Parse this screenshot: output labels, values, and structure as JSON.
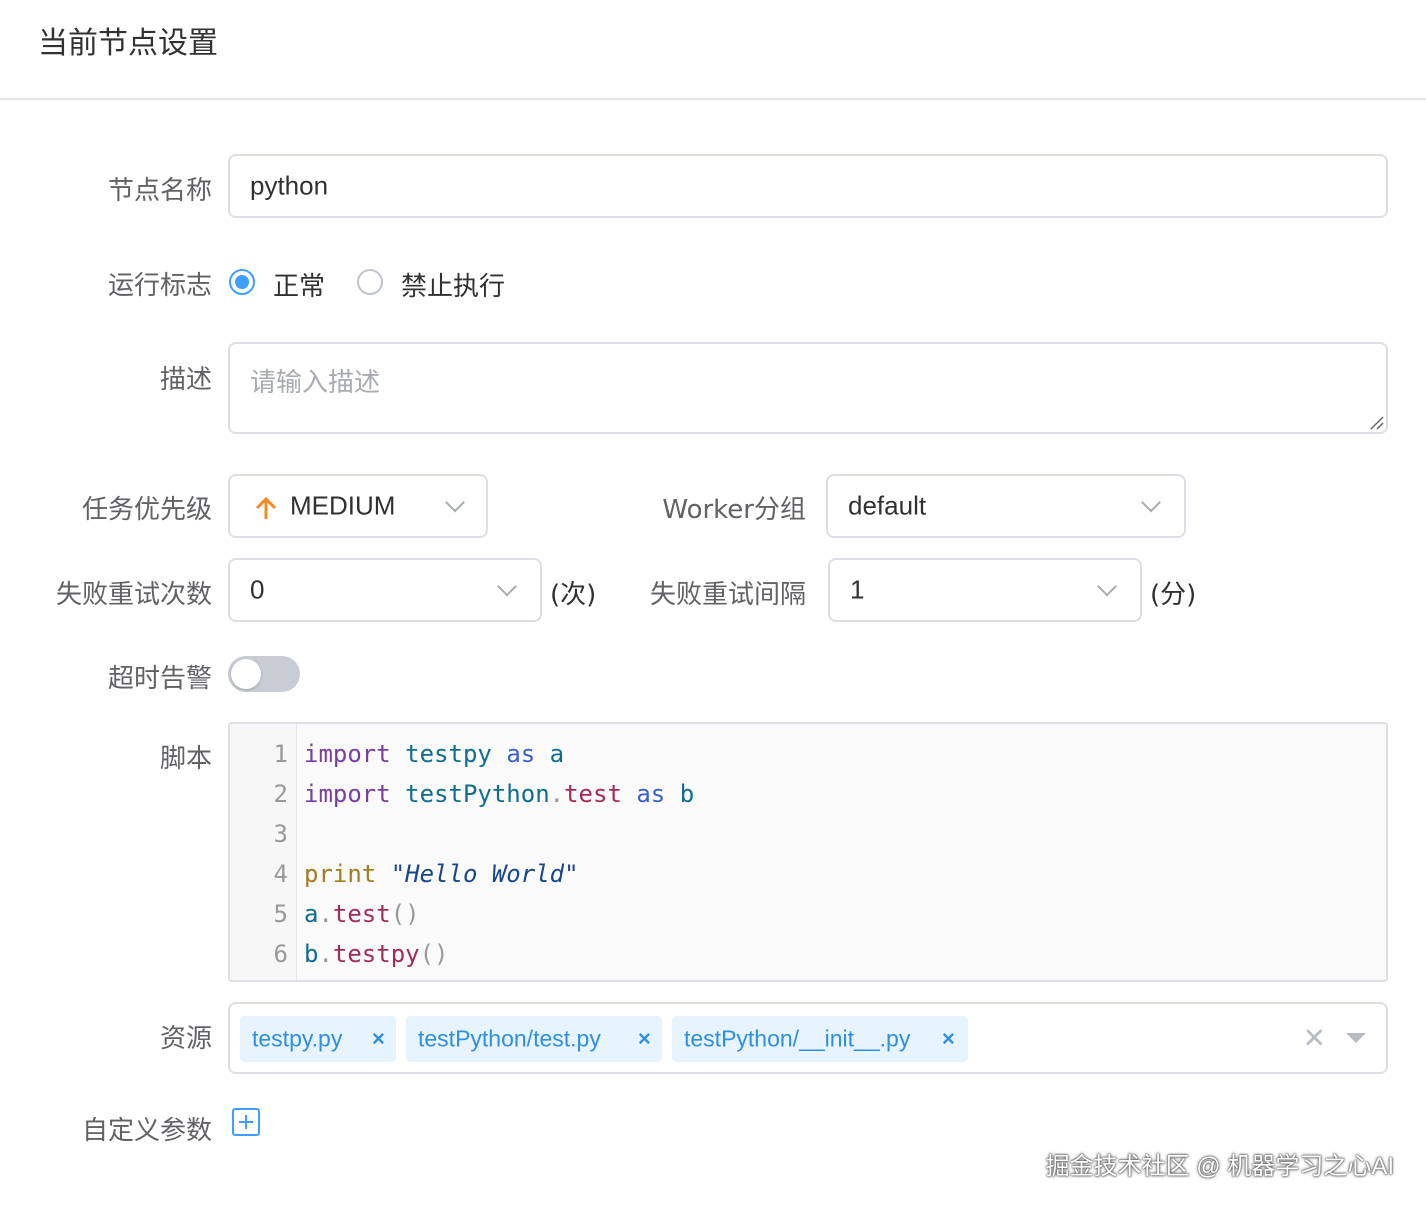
{
  "header": {
    "title": "当前节点设置"
  },
  "form": {
    "node_name": {
      "label": "节点名称",
      "value": "python"
    },
    "run_flag": {
      "label": "运行标志",
      "options": [
        "正常",
        "禁止执行"
      ],
      "selected": "正常"
    },
    "description": {
      "label": "描述",
      "placeholder": "请输入描述"
    },
    "priority": {
      "label": "任务优先级",
      "value": "MEDIUM",
      "icon": "arrow-up-icon",
      "icon_color": "#f08b28"
    },
    "worker_group": {
      "label": "Worker分组",
      "value": "default"
    },
    "retry_count": {
      "label": "失败重试次数",
      "value": "0",
      "unit": "(次)"
    },
    "retry_interval": {
      "label": "失败重试间隔",
      "value": "1",
      "unit": "(分)"
    },
    "timeout_alarm": {
      "label": "超时告警",
      "enabled": false
    },
    "script": {
      "label": "脚本",
      "line_numbers": [
        "1",
        "2",
        "3",
        "4",
        "5",
        "6"
      ],
      "lines": [
        [
          [
            "import",
            "kw"
          ],
          [
            " ",
            ""
          ],
          [
            "testpy",
            "var"
          ],
          [
            " ",
            ""
          ],
          [
            "as",
            "kw2"
          ],
          [
            " ",
            ""
          ],
          [
            "a",
            "var"
          ]
        ],
        [
          [
            "import",
            "kw"
          ],
          [
            " ",
            ""
          ],
          [
            "testPython",
            "var"
          ],
          [
            ".",
            "pn"
          ],
          [
            "test",
            "fn"
          ],
          [
            " ",
            ""
          ],
          [
            "as",
            "kw2"
          ],
          [
            " ",
            ""
          ],
          [
            "b",
            "var"
          ]
        ],
        [],
        [
          [
            "print",
            "pr"
          ],
          [
            " ",
            ""
          ],
          [
            "\"Hello World\"",
            "str"
          ]
        ],
        [
          [
            "a",
            "var"
          ],
          [
            ".",
            "pn"
          ],
          [
            "test",
            "fn"
          ],
          [
            "()",
            "pn"
          ]
        ],
        [
          [
            "b",
            "var"
          ],
          [
            ".",
            "pn"
          ],
          [
            "testpy",
            "fn"
          ],
          [
            "()",
            "pn"
          ]
        ]
      ]
    },
    "resources": {
      "label": "资源",
      "tags": [
        "testpy.py",
        "testPython/test.py",
        "testPython/__init__.py"
      ],
      "tag_close_glyph": "×",
      "clear_glyph": "✕"
    },
    "custom_params": {
      "label": "自定义参数",
      "icon": "plus-square-icon"
    }
  },
  "watermark": "掘金技术社区 @ 机器学习之心AI",
  "colors": {
    "accent": "#409eff",
    "tag_bg": "#e8f4fd",
    "tag_text": "#2f8fe0"
  }
}
